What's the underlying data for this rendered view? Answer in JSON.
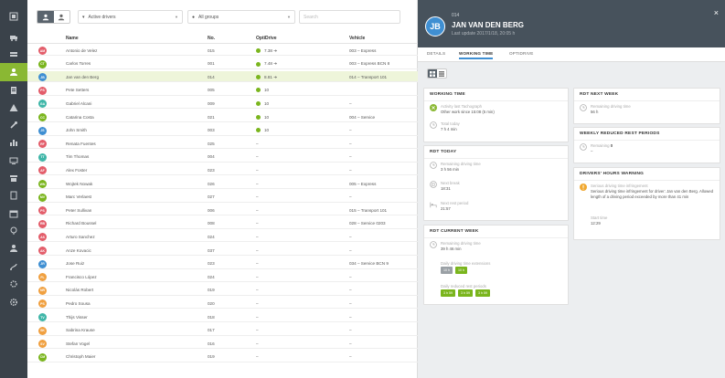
{
  "sidebar": {
    "icons": [
      "dashboard-icon",
      "truck-icon",
      "vehicles-icon",
      "drivers-icon",
      "document-icon",
      "alert-icon",
      "tools-icon",
      "chart-icon",
      "display-icon",
      "archive-icon",
      "file-icon",
      "calendar-icon",
      "location-icon",
      "user-icon",
      "routes-icon",
      "settings-icon",
      "gear-icon"
    ],
    "active_index": 3,
    "active_color": "#8ab833"
  },
  "toolbar": {
    "filter_drivers": "Active drivers",
    "filter_groups": "All groups",
    "search_placeholder": "Search"
  },
  "table": {
    "columns": {
      "name": "Name",
      "no": "No.",
      "opti": "OptiDrive",
      "vehicle": "Vehicle"
    },
    "rows": [
      {
        "i": "AM",
        "color": "#e35d6a",
        "name": "Antonio de Velez",
        "no": "015",
        "opt": "7.38 ➔",
        "veh": "003 – Express"
      },
      {
        "i": "CT",
        "color": "#7ab51d",
        "name": "Carlos Torres",
        "no": "001",
        "opt": "7.48 ➔",
        "veh": "003 – Express BCN 8"
      },
      {
        "i": "JB",
        "color": "#3f8fd2",
        "name": "Jan van den Berg",
        "no": "014",
        "opt": "8.81 ➔",
        "veh": "014 – Transport 101",
        "sel": true
      },
      {
        "i": "PS",
        "color": "#e35d6a",
        "name": "Pete Setters",
        "no": "005",
        "opt": "10",
        "veh": ""
      },
      {
        "i": "GA",
        "color": "#3fb6a8",
        "name": "Gabriel Alcani",
        "no": "009",
        "opt": "10",
        "veh": "–"
      },
      {
        "i": "CC",
        "color": "#7ab51d",
        "name": "Catarina Costa",
        "no": "021",
        "opt": "10",
        "veh": "004 – Service"
      },
      {
        "i": "JS",
        "color": "#3f8fd2",
        "name": "John Smith",
        "no": "003",
        "opt": "10",
        "veh": "–"
      },
      {
        "i": "RF",
        "color": "#e35d6a",
        "name": "Renata Fuentes",
        "no": "025",
        "opt": "–",
        "veh": "–"
      },
      {
        "i": "TT",
        "color": "#3fb6a8",
        "name": "Tim Thomas",
        "no": "004",
        "opt": "–",
        "veh": "–"
      },
      {
        "i": "AF",
        "color": "#e35d6a",
        "name": "Alex Foster",
        "no": "023",
        "opt": "–",
        "veh": "–"
      },
      {
        "i": "WN",
        "color": "#7ab51d",
        "name": "Wojtek Nowak",
        "no": "026",
        "opt": "–",
        "veh": "005 – Express"
      },
      {
        "i": "MV",
        "color": "#7ab51d",
        "name": "Marc Verlaest",
        "no": "027",
        "opt": "–",
        "veh": "–"
      },
      {
        "i": "PS",
        "color": "#e35d6a",
        "name": "Peter Sullivan",
        "no": "006",
        "opt": "–",
        "veh": "015 – Transport 101"
      },
      {
        "i": "RB",
        "color": "#e35d6a",
        "name": "Richard Boussel",
        "no": "008",
        "opt": "–",
        "veh": "028 – Service 0203"
      },
      {
        "i": "AS",
        "color": "#e35d6a",
        "name": "Arturo Sanchez",
        "no": "024",
        "opt": "–",
        "veh": "–"
      },
      {
        "i": "AK",
        "color": "#e35d6a",
        "name": "Anze Kovacic",
        "no": "037",
        "opt": "–",
        "veh": "–"
      },
      {
        "i": "JR",
        "color": "#3f8fd2",
        "name": "Jose Ruiz",
        "no": "023",
        "opt": "–",
        "veh": "034 – Service BCN 9"
      },
      {
        "i": "FL",
        "color": "#f0a040",
        "name": "Francisco López",
        "no": "024",
        "opt": "–",
        "veh": "–"
      },
      {
        "i": "NR",
        "color": "#f0a040",
        "name": "Nicolás Robert",
        "no": "019",
        "opt": "–",
        "veh": "–"
      },
      {
        "i": "PS",
        "color": "#f0a040",
        "name": "Pedro Sousa",
        "no": "020",
        "opt": "–",
        "veh": "–"
      },
      {
        "i": "TV",
        "color": "#3fb6a8",
        "name": "Thijs Visser",
        "no": "018",
        "opt": "–",
        "veh": "–"
      },
      {
        "i": "SK",
        "color": "#f0a040",
        "name": "Sabrina Krause",
        "no": "017",
        "opt": "–",
        "veh": "–"
      },
      {
        "i": "SV",
        "color": "#f0a040",
        "name": "Stefan Vogel",
        "no": "016",
        "opt": "–",
        "veh": "–"
      },
      {
        "i": "CM",
        "color": "#7ab51d",
        "name": "Christoph Maier",
        "no": "019",
        "opt": "–",
        "veh": "–"
      }
    ]
  },
  "detail": {
    "initials": "JB",
    "driver_no": "014",
    "name": "JAN VAN DEN BERG",
    "last_update": "Last update 2017/1/18, 20:05 h",
    "close": "×",
    "tabs": [
      "DETAILS",
      "WORKING TIME",
      "OPTIDRIVE"
    ],
    "active_tab": 1,
    "working_time": {
      "title": "WORKING TIME",
      "item1_label": "Activity last Tachograph",
      "item1_value": "Other work since 15:08 (5 min)",
      "item2_label": "Total today",
      "item2_value": "7 h 4 min"
    },
    "rdt_today": {
      "title": "RDT TODAY",
      "item1_label": "Remaining driving time",
      "item1_value": "3 h 56 min",
      "item2_label": "Next break",
      "item2_value": "18:31",
      "item3_label": "Next rest period",
      "item3_value": "21:57"
    },
    "rdt_current_week": {
      "title": "RDT CURRENT WEEK",
      "item1_label": "Remaining driving time",
      "item1_value": "39 h 46 min",
      "item2_label": "Daily driving time extensions",
      "pills_a": [
        "10 h",
        "10 h"
      ],
      "item3_label": "Daily reduced rest periods",
      "pills_b": [
        "3 h 59",
        "3 h 59",
        "3 h 59"
      ]
    },
    "rdt_next_week": {
      "title": "RDT NEXT WEEK",
      "item1_label": "Remaining driving time",
      "item1_value": "56 h"
    },
    "weekly_reduced": {
      "title": "WEEKLY REDUCED REST PERIODS",
      "item1_label": "Remaining",
      "item1_value": "0",
      "item1_sub": "–"
    },
    "drivers_hours": {
      "title": "DRIVERS' HOURS WARNING",
      "item1_label": "Serious driving time infringement",
      "item1_value": "Serious driving time infringement for driver: Jan van den Berg. Allowed length of a driving period exceeded by more than 41 min",
      "item2_label": "Start time",
      "item2_value": "12:29"
    }
  }
}
